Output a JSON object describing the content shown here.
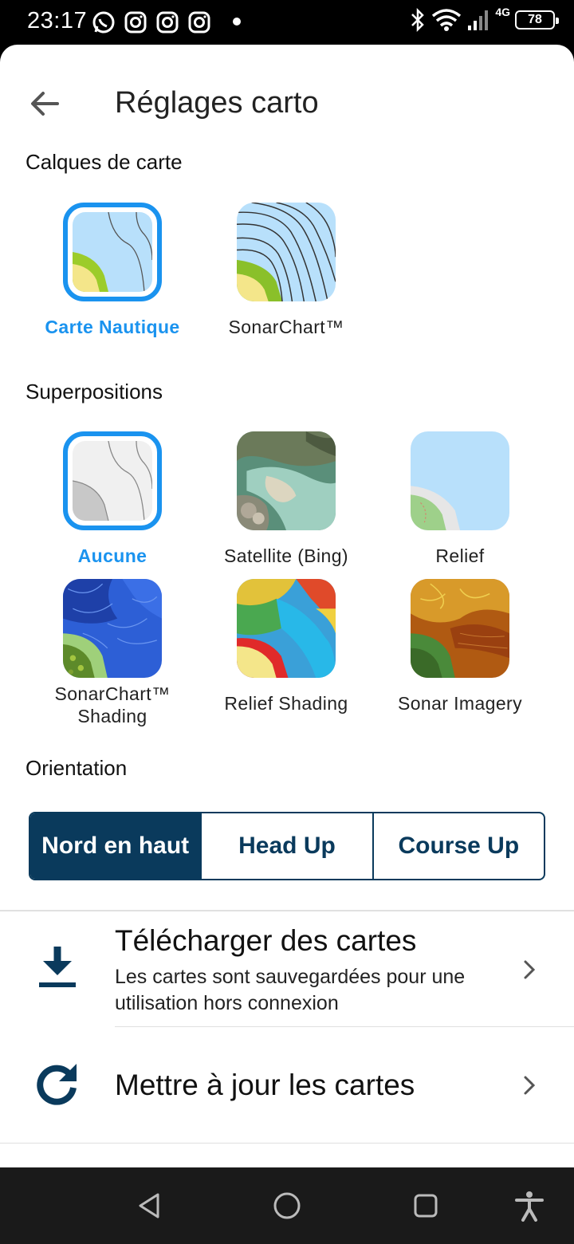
{
  "status_bar": {
    "time": "23:17",
    "network": "4G",
    "battery": "78",
    "icons": [
      "whatsapp-icon",
      "instagram-icon",
      "instagram-icon",
      "instagram-icon",
      "bluetooth-icon",
      "wifi-icon",
      "signal-icon",
      "battery-icon"
    ]
  },
  "header": {
    "title": "Réglages carto",
    "back_icon": "arrow-left-icon"
  },
  "layers": {
    "label": "Calques de carte",
    "items": [
      {
        "label": "Carte Nautique",
        "selected": true
      },
      {
        "label": "SonarChart™",
        "selected": false
      }
    ]
  },
  "overlays": {
    "label": "Superpositions",
    "items": [
      {
        "label": "Aucune",
        "selected": true
      },
      {
        "label": "Satellite (Bing)",
        "selected": false
      },
      {
        "label": "Relief",
        "selected": false
      },
      {
        "label": "SonarChart™ Shading",
        "selected": false
      },
      {
        "label": "Relief Shading",
        "selected": false
      },
      {
        "label": "Sonar Imagery",
        "selected": false
      }
    ]
  },
  "orientation": {
    "label": "Orientation",
    "options": [
      "Nord en haut",
      "Head Up",
      "Course Up"
    ],
    "selected": "Nord en haut"
  },
  "rows": [
    {
      "title": "Télécharger des cartes",
      "subtitle": "Les cartes sont sauvegardées pour une utilisation hors connexion",
      "icon": "download-icon"
    },
    {
      "title": "Mettre à jour les cartes",
      "icon": "refresh-icon"
    }
  ],
  "colors": {
    "accent": "#1a93ef",
    "navy": "#0a3a5c"
  },
  "nav": [
    "back-triangle-icon",
    "home-circle-icon",
    "recents-square-icon",
    "accessibility-icon"
  ]
}
